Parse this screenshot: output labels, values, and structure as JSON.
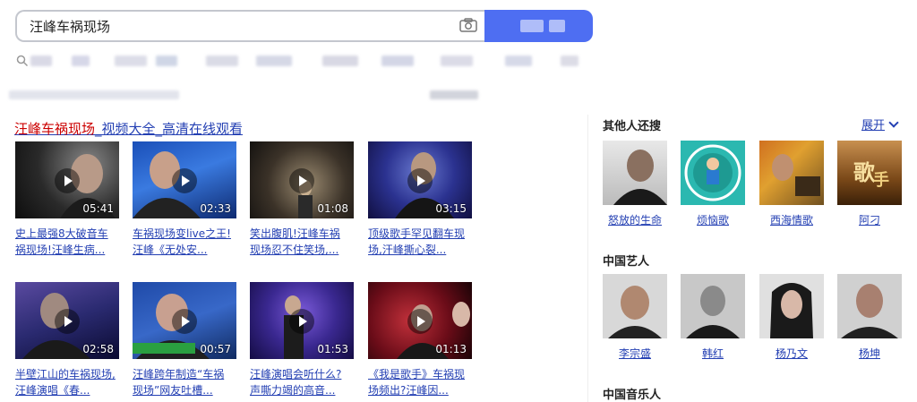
{
  "search": {
    "query": "汪峰车祸现场"
  },
  "result": {
    "title_em": "汪峰车祸现场",
    "title_rest": "_视频大全_高清在线观看"
  },
  "videos": [
    {
      "duration": "05:41",
      "line1": "史上最强8大破音车",
      "line2": "祸现场!汪峰生病..."
    },
    {
      "duration": "02:33",
      "line1": "车祸现场变live之王!",
      "line2": "汪峰《无处安..."
    },
    {
      "duration": "01:08",
      "line1": "笑出腹肌!汪峰车祸",
      "line2": "现场忍不住笑场,..."
    },
    {
      "duration": "03:15",
      "line1": "顶级歌手罕见翻车现",
      "line2": "场,汗峰撕心裂..."
    },
    {
      "duration": "02:58",
      "line1": "半壁江山的车祸现场,",
      "line2": "汪峰演唱《春..."
    },
    {
      "duration": "00:57",
      "line1": "汪峰跨年制造“车祸",
      "line2": "现场”网友吐槽..."
    },
    {
      "duration": "01:53",
      "line1": "汪峰演唱会听什么?",
      "line2": "声嘶力竭的高音..."
    },
    {
      "duration": "01:13",
      "line1": "《我是歌手》车祸现",
      "line2": "场频出?汪峰因..."
    }
  ],
  "sidebar": {
    "others_title": "其他人还搜",
    "expand_label": "展开",
    "others": [
      {
        "name": "怒放的生命"
      },
      {
        "name": "烦恼歌"
      },
      {
        "name": "西海情歌"
      },
      {
        "name": "阿刁"
      }
    ],
    "artists_title": "中国艺人",
    "artists": [
      {
        "name": "李宗盛"
      },
      {
        "name": "韩红"
      },
      {
        "name": "杨乃文"
      },
      {
        "name": "杨坤"
      }
    ],
    "musicians_title": "中国音乐人"
  },
  "colors": {
    "accent": "#4e6ef2",
    "link": "#2440b3",
    "highlight": "#c00000"
  }
}
